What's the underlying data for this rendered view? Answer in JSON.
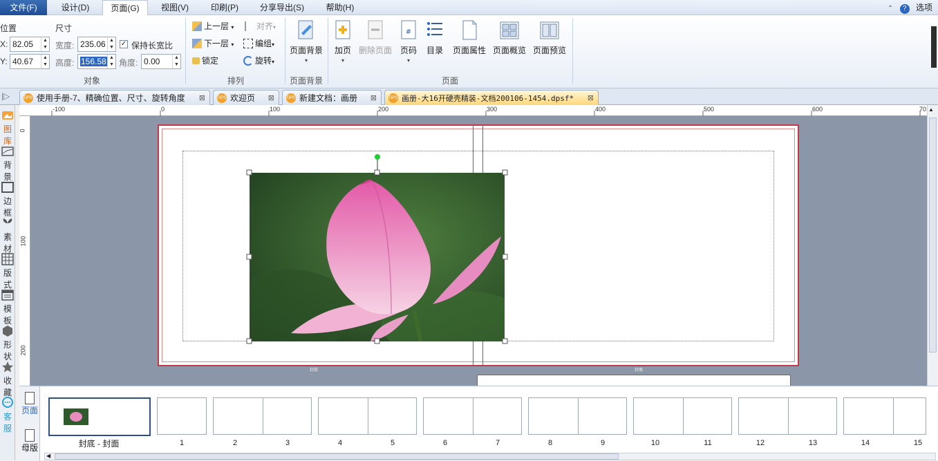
{
  "menu": {
    "file": "文件(F)",
    "design": "设计(D)",
    "page": "页面(G)",
    "view": "视图(V)",
    "print": "印刷(P)",
    "share": "分享导出(S)",
    "help": "帮助(H)",
    "options": "选项"
  },
  "ribbon": {
    "object": {
      "position_title": "位置",
      "x_label": "X:",
      "x_value": "82.05",
      "y_label": "Y:",
      "y_value": "40.67",
      "size_title": "尺寸",
      "width_label": "宽度:",
      "width_value": "235.06",
      "height_label": "高度:",
      "height_value": "156.58",
      "keep_ratio_label": "保持长宽比",
      "keep_ratio_checked": true,
      "angle_label": "角度:",
      "angle_value": "0.00",
      "group_label": "对象"
    },
    "arrange": {
      "bring_up": "上一层",
      "send_down": "下一层",
      "lock": "锁定",
      "align": "对齐",
      "group": "编组",
      "rotate": "旋转",
      "group_label": "排列"
    },
    "background": {
      "page_bg": "页面背景",
      "group_label": "页面背景"
    },
    "page": {
      "add_page": "加页",
      "delete_page": "删除页面",
      "page_number": "页码",
      "toc": "目录",
      "page_props": "页面属性",
      "page_overview": "页面概览",
      "page_preview": "页面预览",
      "group_label": "页面"
    }
  },
  "tabs": [
    {
      "label": "使用手册-7、精确位置、尺寸、旋转角度",
      "active": false
    },
    {
      "label": "欢迎页",
      "active": false
    },
    {
      "label": "新建文档：画册",
      "active": false
    },
    {
      "label": "画册-大16开硬壳精装-文档200106-1454.dpsf*",
      "active": true
    }
  ],
  "tab_icon_text": "DPS",
  "tab_close": "⊠",
  "sidebar": [
    {
      "label": "图库",
      "icon": "gallery-icon"
    },
    {
      "label": "背景",
      "icon": "background-icon"
    },
    {
      "label": "边框",
      "icon": "border-icon"
    },
    {
      "label": "素材",
      "icon": "material-icon"
    },
    {
      "label": "版式",
      "icon": "layout-icon"
    },
    {
      "label": "模板",
      "icon": "template-icon"
    },
    {
      "label": "形状",
      "icon": "shape-icon"
    },
    {
      "label": "收藏",
      "icon": "star-icon"
    },
    {
      "label": "客服",
      "icon": "support-icon"
    }
  ],
  "ruler": {
    "h_ticks": [
      "-100",
      "0",
      "100",
      "200",
      "300",
      "400",
      "500",
      "600",
      "70"
    ],
    "v_ticks": [
      "0",
      "100",
      "200"
    ]
  },
  "canvas": {
    "left_page_label": "封底",
    "right_page_label": "封面"
  },
  "bottom": {
    "pages_tab": "页面",
    "master_tab": "母版",
    "first_label": "封底 - 封面",
    "page_numbers": [
      "1",
      "2",
      "3",
      "4",
      "5",
      "6",
      "7",
      "8",
      "9",
      "10",
      "11",
      "12",
      "13",
      "14",
      "15"
    ]
  },
  "colors": {
    "accent": "#2a66c7",
    "page_border": "#c23a4a",
    "canvas_bg": "#8b96a8",
    "handle_green": "#22cc33"
  }
}
